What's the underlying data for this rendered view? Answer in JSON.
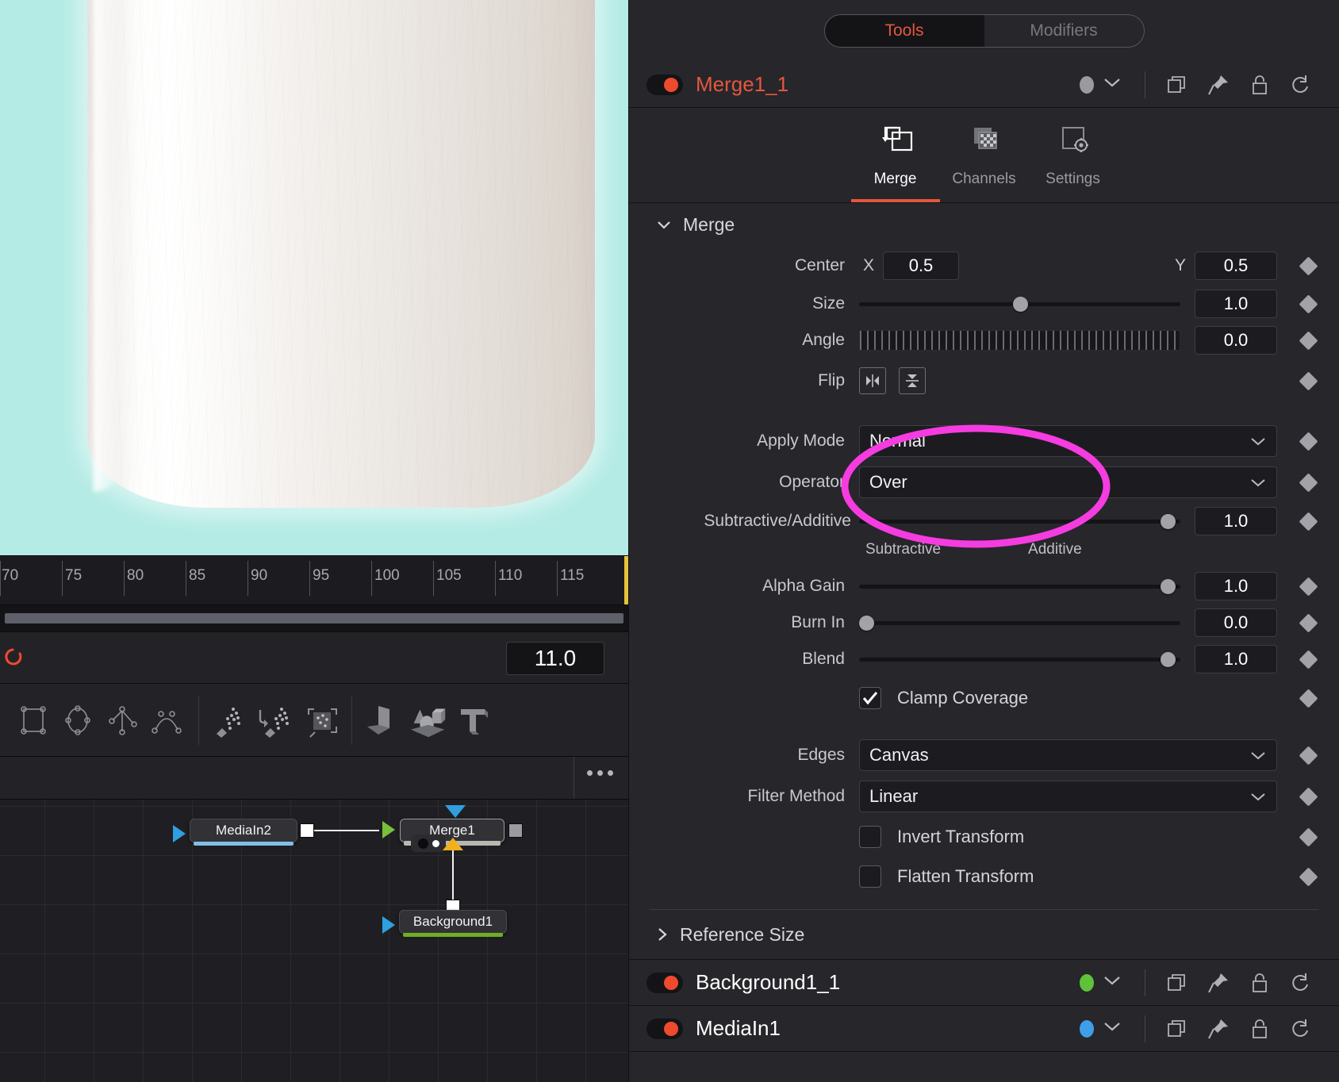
{
  "panel": {
    "segmented": {
      "tools": "Tools",
      "modifiers": "Modifiers",
      "active": "Tools"
    },
    "node_header": {
      "name": "Merge1_1",
      "color_dot": "#9a9aa0"
    },
    "tabs": [
      {
        "label": "Merge",
        "icon": "merge-icon",
        "active": true
      },
      {
        "label": "Channels",
        "icon": "channels-icon",
        "active": false
      },
      {
        "label": "Settings",
        "icon": "settings-icon",
        "active": false
      }
    ],
    "section_title": "Merge",
    "controls": {
      "center": {
        "label": "Center",
        "x_label": "X",
        "x_value": "0.5",
        "y_label": "Y",
        "y_value": "0.5"
      },
      "size": {
        "label": "Size",
        "value": "1.0",
        "knob_pct": 50
      },
      "angle": {
        "label": "Angle",
        "value": "0.0"
      },
      "flip": {
        "label": "Flip",
        "horizontal_icon": "flip-horizontal-icon",
        "vertical_icon": "flip-vertical-icon"
      },
      "apply_mode": {
        "label": "Apply Mode",
        "value": "Normal"
      },
      "operator": {
        "label": "Operator",
        "value": "Over"
      },
      "subtractive_additive": {
        "label": "Subtractive/Additive",
        "value": "1.0",
        "knob_pct": 96,
        "min_label": "Subtractive",
        "max_label": "Additive"
      },
      "alpha_gain": {
        "label": "Alpha Gain",
        "value": "1.0",
        "knob_pct": 96
      },
      "burn_in": {
        "label": "Burn In",
        "value": "0.0",
        "knob_pct": 2
      },
      "blend": {
        "label": "Blend",
        "value": "1.0",
        "knob_pct": 96
      },
      "clamp_coverage": {
        "label": "Clamp Coverage",
        "checked": true
      },
      "edges": {
        "label": "Edges",
        "value": "Canvas"
      },
      "filter_method": {
        "label": "Filter Method",
        "value": "Linear"
      },
      "invert_transform": {
        "label": "Invert Transform",
        "checked": false
      },
      "flatten_transform": {
        "label": "Flatten Transform",
        "checked": false
      }
    },
    "reference_size": {
      "label": "Reference Size",
      "expanded": false
    },
    "node_list": [
      {
        "name": "Background1_1",
        "dot_color": "#5fc23a"
      },
      {
        "name": "MediaIn1",
        "dot_color": "#3e9ee8"
      }
    ]
  },
  "viewer": {
    "background_color": "#b4ebe5",
    "ruler_ticks": [
      "70",
      "75",
      "80",
      "85",
      "90",
      "95",
      "100",
      "105",
      "110",
      "115"
    ],
    "current_time": "11.0"
  },
  "toolbar": {
    "icons": [
      "rectangle-mask-icon",
      "ellipse-mask-icon",
      "polygon-mask-icon",
      "bspline-mask-icon",
      "paint-icon",
      "paint-stroke-icon",
      "paint-region-icon",
      "plane3d-icon",
      "shape3d-icon",
      "text3d-icon"
    ],
    "overflow": "more-options-icon"
  },
  "node_graph": {
    "nodes": [
      {
        "name": "MediaIn2",
        "bar_color": "#7fbfe8"
      },
      {
        "name": "Merge1",
        "bar_color": "#b8b8b0",
        "selected": true
      },
      {
        "name": "Background1",
        "bar_color": "#6fae26"
      }
    ]
  },
  "annotation": {
    "shape": "ellipse",
    "color": "#f53ce0"
  }
}
